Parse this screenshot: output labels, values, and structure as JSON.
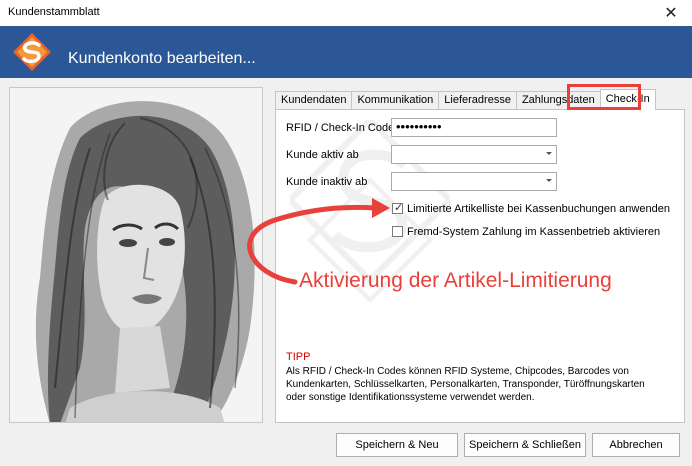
{
  "window": {
    "title": "Kundenstammblatt",
    "close_glyph": "✕"
  },
  "header": {
    "title": "Kundenkonto bearbeiten...",
    "logo_icon": "app-logo-icon",
    "accent": "#2b5797"
  },
  "tabs": [
    {
      "label": "Kundendaten"
    },
    {
      "label": "Kommunikation"
    },
    {
      "label": "Lieferadresse"
    },
    {
      "label": "Zahlungsdaten"
    },
    {
      "label": "Check-In"
    }
  ],
  "form": {
    "rfid_label": "RFID / Check-In Code",
    "rfid_value": "••••••••••",
    "aktiv_label": "Kunde aktiv ab",
    "inaktiv_label": "Kunde inaktiv ab",
    "cb1_label": "Limitierte Artikelliste bei Kassenbuchungen anwenden",
    "cb1_checked": true,
    "cb2_label": "Fremd-System Zahlung im Kassenbetrieb aktivieren",
    "cb2_checked": false
  },
  "annotation": {
    "text": "Aktivierung der Artikel-Limitierung",
    "color": "#e8403b"
  },
  "tip": {
    "title": "TIPP",
    "text": "Als RFID / Check-In Codes können RFID Systeme, Chipcodes, Barcodes von Kundenkarten, Schlüsselkarten, Personalkarten, Transponder, Türöffnungskarten oder sonstige Identifikationssysteme verwendet werden."
  },
  "buttons": {
    "save_new": "Speichern & Neu",
    "save_close": "Speichern & Schließen",
    "cancel": "Abbrechen"
  }
}
